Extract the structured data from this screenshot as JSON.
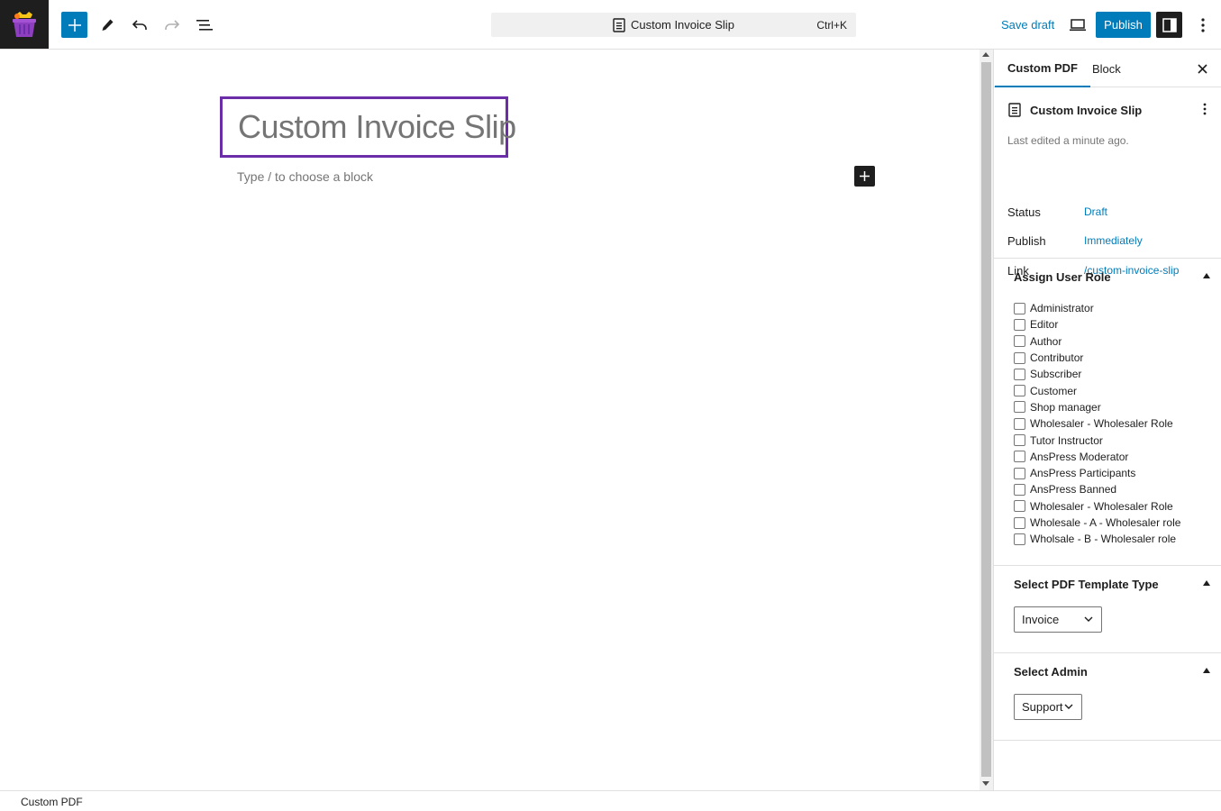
{
  "toolbar": {
    "add_block_icon": "plus-icon",
    "edit_icon": "pencil-icon",
    "undo_icon": "undo-icon",
    "redo_icon": "redo-icon",
    "list_view_icon": "list-view-icon",
    "command_bar": {
      "title": "Custom Invoice Slip",
      "shortcut": "Ctrl+K"
    },
    "save_draft_label": "Save draft",
    "publish_label": "Publish"
  },
  "editor": {
    "title": "Custom Invoice Slip",
    "block_placeholder": "Type / to choose a block"
  },
  "sidebar": {
    "tabs": [
      {
        "label": "Custom PDF",
        "active": true
      },
      {
        "label": "Block",
        "active": false
      }
    ],
    "document": {
      "title": "Custom Invoice Slip",
      "last_edited": "Last edited a minute ago.",
      "status_label": "Status",
      "status_value": "Draft",
      "publish_label": "Publish",
      "publish_value": "Immediately",
      "link_label": "Link",
      "link_value": "/custom-invoice-slip"
    },
    "assign_user_role": {
      "title": "Assign User Role",
      "roles": [
        "Administrator",
        "Editor",
        "Author",
        "Contributor",
        "Subscriber",
        "Customer",
        "Shop manager",
        "Wholesaler - Wholesaler Role",
        "Tutor Instructor",
        "AnsPress Moderator",
        "AnsPress Participants",
        "AnsPress Banned",
        "Wholesaler - Wholesaler Role",
        "Wholesale - A - Wholesaler role",
        "Wholsale - B - Wholesaler role"
      ]
    },
    "pdf_template_type": {
      "title": "Select PDF Template Type",
      "selected": "Invoice"
    },
    "select_admin": {
      "title": "Select Admin",
      "selected": "Support"
    }
  },
  "footer": {
    "breadcrumb": "Custom PDF"
  },
  "colors": {
    "accent": "#007cba",
    "title_outline": "#6b2da8",
    "dark": "#1e1e1e"
  }
}
